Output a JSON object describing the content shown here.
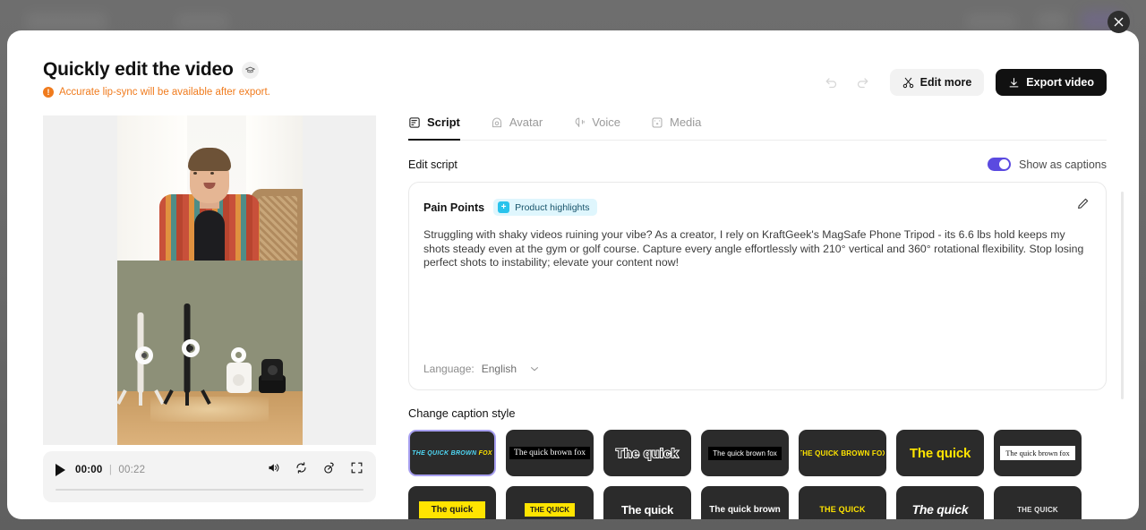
{
  "overlay": {
    "close_icon": "close-icon"
  },
  "header": {
    "title": "Quickly edit the video",
    "title_badge_icon": "graduation-cap-icon",
    "notice": "Accurate lip-sync will be available after export.",
    "notice_icon": "warning-icon",
    "undo_icon": "undo-icon",
    "redo_icon": "redo-icon",
    "edit_more_label": "Edit more",
    "edit_more_icon": "scissors-icon",
    "export_label": "Export video",
    "export_icon": "download-icon"
  },
  "player": {
    "current_time": "00:00",
    "separator": "|",
    "duration": "00:22",
    "play_icon": "play-icon",
    "volume_icon": "volume-icon",
    "loop_icon": "loop-icon",
    "speed_icon": "playback-speed-icon",
    "fullscreen_icon": "fullscreen-icon",
    "progress_percent": 0
  },
  "tabs": [
    {
      "label": "Script",
      "icon": "script-icon",
      "active": true
    },
    {
      "label": "Avatar",
      "icon": "avatar-icon",
      "active": false
    },
    {
      "label": "Voice",
      "icon": "voice-icon",
      "active": false
    },
    {
      "label": "Media",
      "icon": "media-icon",
      "active": false
    }
  ],
  "script_section": {
    "label": "Edit script",
    "toggle_label": "Show as captions",
    "toggle_on": true,
    "toggle_color": "#5b4ae0",
    "card": {
      "heading": "Pain Points",
      "chip_label": "Product highlights",
      "chip_icon": "plus-square-icon",
      "chip_bg": "#dff6fd",
      "chip_accent": "#29c3ec",
      "edit_icon": "pencil-icon",
      "text": "Struggling with shaky videos ruining your vibe? As a creator, I rely on KraftGeek's MagSafe Phone Tripod - its 6.6 lbs hold keeps my shots steady even at the gym or golf course. Capture every angle effortlessly with 210° vertical and 360° rotational flexibility. Stop losing perfect shots to instability; elevate your content now!",
      "language_label": "Language:",
      "language_value": "English",
      "language_chevron_icon": "chevron-down-icon"
    }
  },
  "caption_styles": {
    "heading": "Change caption style",
    "selected_index": 0,
    "items": [
      {
        "text": "THE QUICK BROWN ",
        "accent_text": "FOX",
        "variant": "s1",
        "selected": true
      },
      {
        "text": "The quick brown fox",
        "variant": "s2",
        "selected": false
      },
      {
        "text": "The quick",
        "variant": "s3",
        "selected": false
      },
      {
        "text": "The quick brown fox",
        "variant": "s4",
        "selected": false
      },
      {
        "text": "THE QUICK BROWN FOX",
        "variant": "s5",
        "selected": false
      },
      {
        "text": "The quick",
        "variant": "s6",
        "selected": false
      },
      {
        "text": "The quick brown fox",
        "variant": "s7",
        "selected": false
      },
      {
        "text": "The quick",
        "variant": "s8",
        "selected": false
      },
      {
        "text": "THE QUICK",
        "variant": "s9",
        "selected": false
      },
      {
        "text": "The quick",
        "variant": "s10",
        "selected": false
      },
      {
        "text": "The quick brown",
        "variant": "s11",
        "selected": false
      },
      {
        "text": "THE QUICK",
        "variant": "s12",
        "selected": false
      },
      {
        "text": "The quick",
        "variant": "s13",
        "selected": false
      },
      {
        "text": "THE QUICK",
        "variant": "s14",
        "selected": false
      }
    ]
  }
}
